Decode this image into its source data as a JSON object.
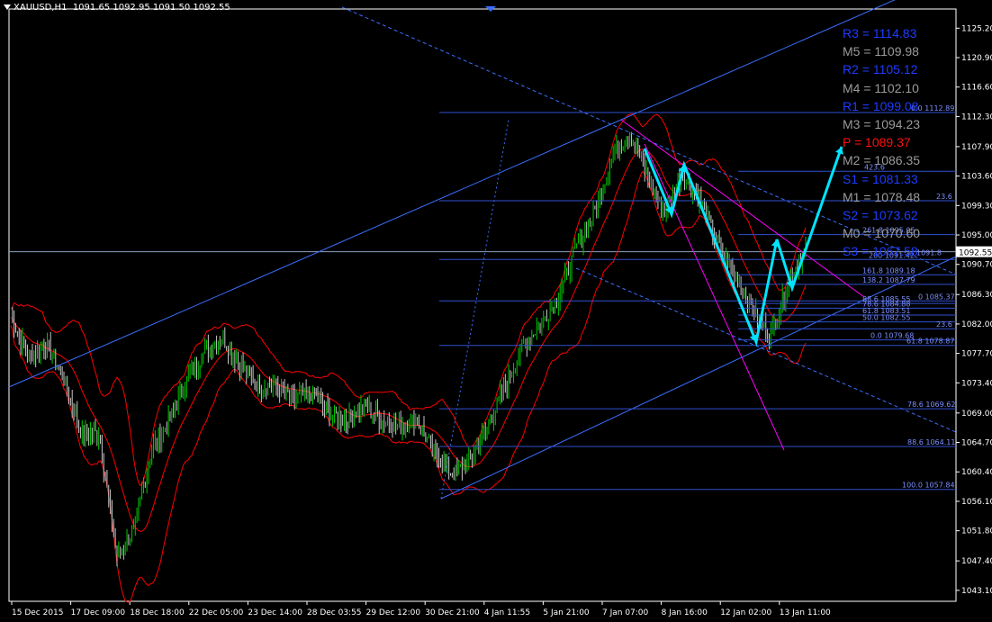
{
  "header": {
    "symbol": "XAUUSD,H1",
    "ohlc": "1091.65 1092.95 1091.50 1092.55"
  },
  "chart_data": {
    "type": "candlestick",
    "symbol": "XAUUSD",
    "timeframe": "H1",
    "ylim": [
      1041.5,
      1128.0
    ],
    "y_ticks": [
      "1125.20",
      "1120.90",
      "1116.60",
      "1112.30",
      "1107.90",
      "1103.60",
      "1099.30",
      "1095.00",
      "1090.70",
      "1086.30",
      "1082.00",
      "1077.70",
      "1073.40",
      "1069.00",
      "1064.70",
      "1060.40",
      "1056.10",
      "1051.80",
      "1047.40",
      "1043.10"
    ],
    "x_ticks": [
      "15 Dec 2015",
      "17 Dec 09:00",
      "18 Dec 18:00",
      "22 Dec 05:00",
      "23 Dec 14:00",
      "28 Dec 03:55",
      "29 Dec 12:00",
      "30 Dec 21:00",
      "4 Jan 11:55",
      "5 Jan 21:00",
      "7 Jan 07:00",
      "8 Jan 16:00",
      "12 Jan 02:00",
      "13 Jan 11:00"
    ],
    "current_price": "1092.55",
    "approx_close_path": [
      1083,
      1077,
      1079,
      1074,
      1066,
      1066,
      1048,
      1052,
      1064,
      1068,
      1074,
      1078,
      1080,
      1076,
      1073,
      1073,
      1071,
      1072,
      1069,
      1068,
      1070,
      1068,
      1067,
      1068,
      1063,
      1060,
      1062,
      1067,
      1073,
      1079,
      1082,
      1086,
      1093,
      1098,
      1106,
      1110,
      1104,
      1098,
      1104,
      1100,
      1094,
      1089,
      1084,
      1080,
      1088,
      1093
    ],
    "pivot_levels": [
      {
        "label": "R3 = 1114.83",
        "color": "#1e3cff"
      },
      {
        "label": "M5 = 1109.98",
        "color": "#9a9a9a"
      },
      {
        "label": "R2 = 1105.12",
        "color": "#1e3cff"
      },
      {
        "label": "M4 = 1102.10",
        "color": "#9a9a9a"
      },
      {
        "label": "R1 = 1099.08",
        "color": "#1e3cff"
      },
      {
        "label": "M3 = 1094.23",
        "color": "#9a9a9a"
      },
      {
        "label": "P  = 1089.37",
        "color": "#ff1010"
      },
      {
        "label": "M2 = 1086.35",
        "color": "#9a9a9a"
      },
      {
        "label": "S1 = 1081.33",
        "color": "#1e3cff"
      },
      {
        "label": "M1 = 1078.48",
        "color": "#9a9a9a"
      },
      {
        "label": "S2 = 1073.62",
        "color": "#1e3cff"
      },
      {
        "label": "M0 = 1070.60",
        "color": "#9a9a9a"
      },
      {
        "label": "S3 = 1067.58",
        "color": "#1e3cff"
      }
    ],
    "fib_levels": [
      {
        "label": "0.0 1112.89",
        "value": 1112.89
      },
      {
        "label": "23.6",
        "value": 1100.0
      },
      {
        "label": "261.8 1095.05",
        "value": 1095.05
      },
      {
        "label": "423.6",
        "value": 1104.3
      },
      {
        "label": "200 1091.42",
        "value": 1091.42
      },
      {
        "label": "1091.8",
        "value": 1091.8
      },
      {
        "label": "161.8 1089.18",
        "value": 1089.18
      },
      {
        "label": "138.2 1087.79",
        "value": 1087.79
      },
      {
        "label": "0 1085.37",
        "value": 1085.37
      },
      {
        "label": "88.6 1085.55",
        "value": 1085.0
      },
      {
        "label": "78.6 1084.88",
        "value": 1084.3
      },
      {
        "label": "61.8 1083.51",
        "value": 1083.3
      },
      {
        "label": "50.0 1082.55",
        "value": 1082.3
      },
      {
        "label": "23.6",
        "value": 1081.3
      },
      {
        "label": "0.0 1079.68",
        "value": 1079.68
      },
      {
        "label": "61.8 1078.87",
        "value": 1078.87
      },
      {
        "label": "78.6 1069.62",
        "value": 1069.62
      },
      {
        "label": "88.6 1064.11",
        "value": 1064.11
      },
      {
        "label": "100.0 1057.84",
        "value": 1057.84
      }
    ],
    "colors": {
      "background": "#000000",
      "candle_up": "#00c800",
      "candle_down": "#c8c8c8",
      "bollinger": "#ff0000",
      "channel": "#3a6fff",
      "fib": "#3050d0",
      "pattern_arrow": "#00e5ff",
      "magenta_trend": "#ff00ff"
    }
  }
}
